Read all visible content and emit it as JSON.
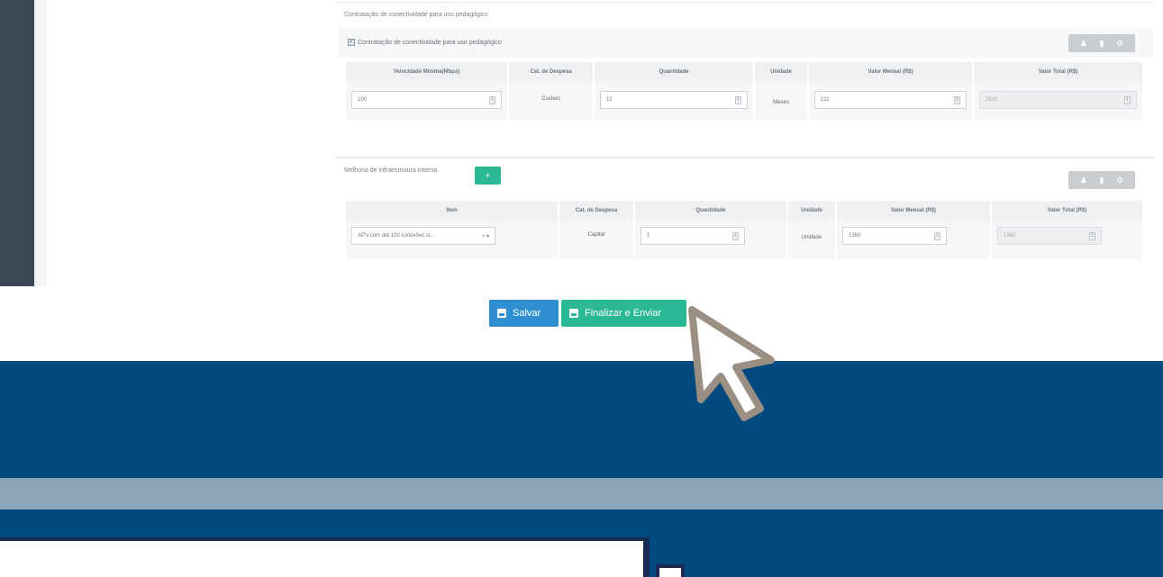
{
  "conectividade": {
    "section_title": "Contratação de conectividade para uso pedagógico",
    "checkbox_label": "Contratação de conectividade para uso pedagógico",
    "checkbox_checked": true,
    "headers": [
      "Velocidade Mínima(Mbps)",
      "Cat. de Despesa",
      "Quantidade",
      "Unidade",
      "Valor Mensal (R$)",
      "Valor Total (R$)"
    ],
    "row": {
      "velocidade": "100",
      "categoria": "Custeio",
      "quantidade": "12",
      "unidade": "Meses",
      "valor_mensal": "211",
      "valor_total": "2532"
    }
  },
  "infraestrutura": {
    "section_title": "Melhoria de infraestrutura interna",
    "add_label": "+",
    "headers": [
      "Item",
      "Cat. de Despesa",
      "Quantidade",
      "Unidade",
      "Valor Mensal (R$)",
      "Valor Total (R$)"
    ],
    "row": {
      "item": "AP's com até 100 conexões si...",
      "categoria": "Capital",
      "quantidade": "1",
      "unidade": "Unidade",
      "valor_mensal": "1360",
      "valor_total": "1360"
    }
  },
  "actions": {
    "save_label": "Salvar",
    "send_label": "Finalizar e Enviar"
  },
  "colors": {
    "primary_blue": "#2f8fd0",
    "success_green": "#2bb894",
    "footer_blue": "#004a80",
    "footer_grey": "#8aa4ba"
  }
}
